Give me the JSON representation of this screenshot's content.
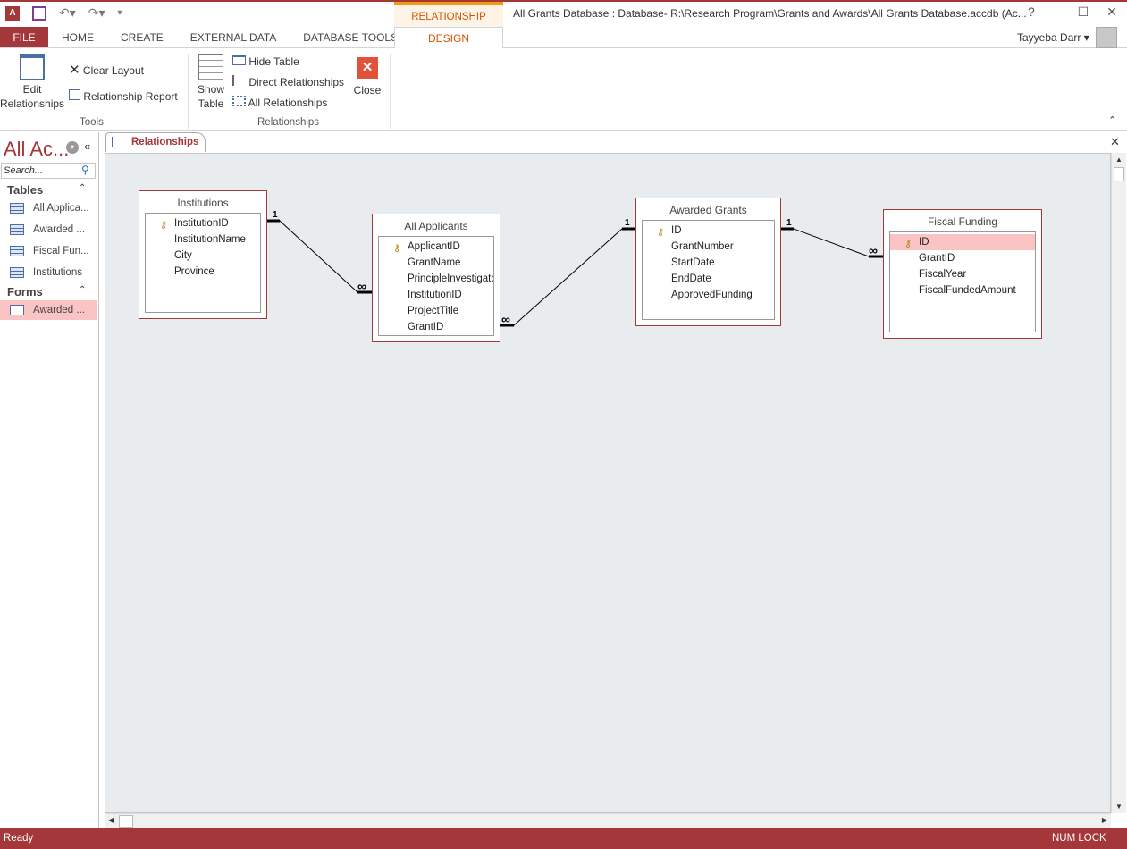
{
  "window": {
    "title": "All Grants Database : Database- R:\\Research Program\\Grants and Awards\\All Grants Database.accdb (Ac...",
    "context_tab": "RELATIONSHIP TOOLS",
    "user": "Tayyeba Darr",
    "help": "?",
    "minimize": "–",
    "maximize": "☐",
    "close": "✕"
  },
  "tabs": [
    "FILE",
    "HOME",
    "CREATE",
    "EXTERNAL DATA",
    "DATABASE TOOLS",
    "DESIGN"
  ],
  "ribbon": {
    "edit_relationships": "Edit Relationships",
    "clear_layout": "Clear Layout",
    "relationship_report": "Relationship Report",
    "tools_group": "Tools",
    "show_table": "Show Table",
    "hide_table": "Hide Table",
    "direct_relationships": "Direct Relationships",
    "all_relationships": "All Relationships",
    "close": "Close",
    "relationships_group": "Relationships"
  },
  "nav": {
    "title": "All Ac...",
    "search_placeholder": "Search...",
    "tables_header": "Tables",
    "tables": [
      "All Applica...",
      "Awarded ...",
      "Fiscal Fun...",
      "Institutions"
    ],
    "forms_header": "Forms",
    "forms": [
      "Awarded ..."
    ]
  },
  "document": {
    "tab": "Relationships"
  },
  "tables": [
    {
      "name": "Institutions",
      "fields": [
        "InstitutionID",
        "InstitutionName",
        "City",
        "Province"
      ],
      "key": 0
    },
    {
      "name": "All Applicants",
      "fields": [
        "ApplicantID",
        "GrantName",
        "PrincipleInvestigator",
        "InstitutionID",
        "ProjectTitle",
        "GrantID"
      ],
      "key": 0
    },
    {
      "name": "Awarded Grants",
      "fields": [
        "ID",
        "GrantNumber",
        "StartDate",
        "EndDate",
        "ApprovedFunding"
      ],
      "key": 0
    },
    {
      "name": "Fiscal Funding",
      "fields": [
        "ID",
        "GrantID",
        "FiscalYear",
        "FiscalFundedAmount"
      ],
      "key": 0,
      "selected": 0
    }
  ],
  "relationships": {
    "one": "1",
    "many": "∞"
  },
  "status": {
    "left": "Ready",
    "right": "NUM LOCK"
  }
}
